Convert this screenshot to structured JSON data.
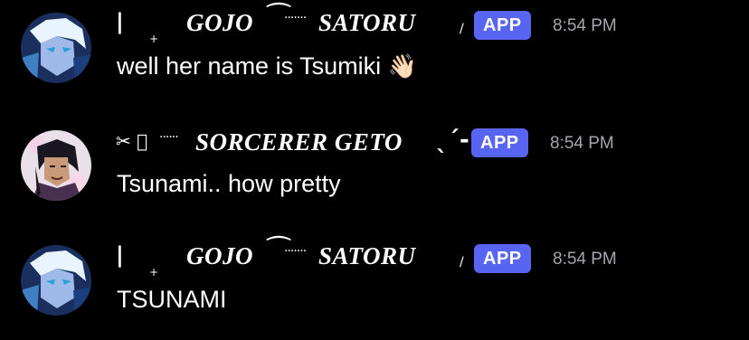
{
  "messages": [
    {
      "deco_left": "|",
      "deco_plus": "+",
      "name_part1": "GOJO",
      "name_arc": "⁀",
      "name_dots": "·······",
      "name_part2": "SATORU",
      "deco_slash": "/",
      "badge": "APP",
      "time": "8:54 PM",
      "text": "well her name is Tsumiki",
      "emoji": "👋🏻",
      "avatar_icon": "gojo-avatar"
    },
    {
      "deco_prefix": "✂ ⃝",
      "name_dots": "······",
      "name": "SORCERER GETO",
      "name_suffix": "ˎˊ-",
      "badge": "APP",
      "time": "8:54 PM",
      "text": "Tsunami.. how pretty",
      "avatar_icon": "geto-avatar"
    },
    {
      "deco_left": "|",
      "deco_plus": "+",
      "name_part1": "GOJO",
      "name_arc": "⁀",
      "name_dots": "·······",
      "name_part2": "SATORU",
      "deco_slash": "/",
      "badge": "APP",
      "time": "8:54 PM",
      "text": "TSUNAMI",
      "avatar_icon": "gojo-avatar"
    }
  ],
  "colors": {
    "background": "#000000",
    "badge": "#5865f2",
    "timestamp": "#a3a6aa"
  }
}
